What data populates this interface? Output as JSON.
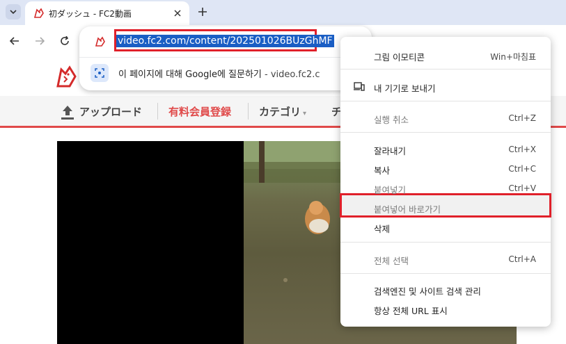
{
  "browser": {
    "tab": {
      "title": "初ダッシュ - FC2動画"
    },
    "omnibox": {
      "url": "video.fc2.com/content/202501026BUzGhMF",
      "suggestion_text": "이 페이지에 대해 Google에 질문하기",
      "suggestion_domain": " - video.fc2.c"
    }
  },
  "site_nav": {
    "upload": "アップロード",
    "premium": "有料会員登録",
    "category": "カテゴリ",
    "category_arrow": "▾",
    "truncated": "チ"
  },
  "context_menu": {
    "emoji_label": "그림 이모티콘",
    "emoji_shortcut": "Win+마침표",
    "send_to_device": "내 기기로 보내기",
    "undo_label": "실행 취소",
    "undo_shortcut": "Ctrl+Z",
    "cut_label": "잘라내기",
    "cut_shortcut": "Ctrl+X",
    "copy_label": "복사",
    "copy_shortcut": "Ctrl+C",
    "paste_label": "붙여넣기",
    "paste_shortcut": "Ctrl+V",
    "paste_go_label": "붙여넣어 바로가기",
    "delete_label": "삭제",
    "select_all_label": "전체 선택",
    "select_all_shortcut": "Ctrl+A",
    "manage_search": "검색엔진 및 사이트 검색 관리",
    "always_full_url": "항상 전체 URL 표시"
  },
  "colors": {
    "accent_red": "#e0202a",
    "selection_blue": "#1a5ec4",
    "site_red": "#e04a4a"
  }
}
